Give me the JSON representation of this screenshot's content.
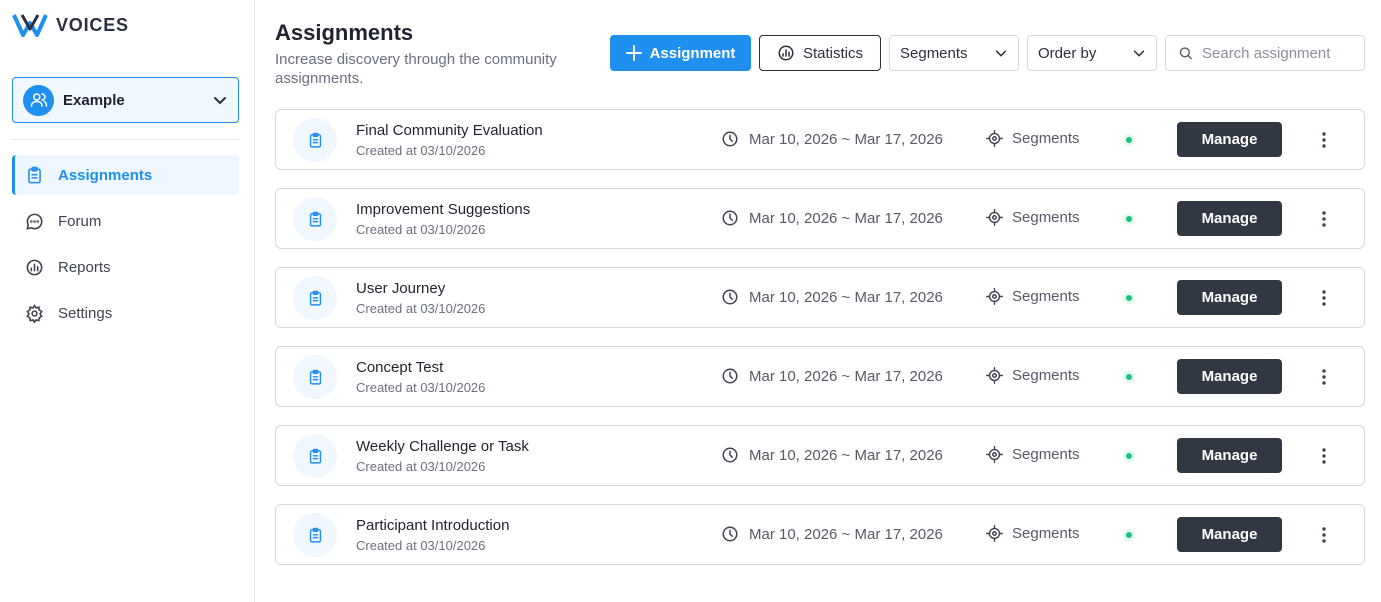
{
  "app": {
    "name": "VOICES"
  },
  "workspace": {
    "name": "Example"
  },
  "nav": [
    {
      "label": "Assignments",
      "icon": "clipboard-icon",
      "active": true
    },
    {
      "label": "Forum",
      "icon": "chat-icon",
      "active": false
    },
    {
      "label": "Reports",
      "icon": "chart-icon",
      "active": false
    },
    {
      "label": "Settings",
      "icon": "gear-icon",
      "active": false
    }
  ],
  "header": {
    "title": "Assignments",
    "subtitle": "Increase discovery through the community assignments."
  },
  "toolbar": {
    "add_label": "Assignment",
    "statistics_label": "Statistics",
    "segments_label": "Segments",
    "order_label": "Order by",
    "search_placeholder": "Search assignment"
  },
  "assignments": [
    {
      "title": "Final Community Evaluation",
      "created": "Created at 03/10/2026",
      "dates": "Mar 10, 2026 ~ Mar 17, 2026",
      "segments": "Segments",
      "manage": "Manage"
    },
    {
      "title": "Improvement Suggestions",
      "created": "Created at 03/10/2026",
      "dates": "Mar 10, 2026 ~ Mar 17, 2026",
      "segments": "Segments",
      "manage": "Manage"
    },
    {
      "title": "User Journey",
      "created": "Created at 03/10/2026",
      "dates": "Mar 10, 2026 ~ Mar 17, 2026",
      "segments": "Segments",
      "manage": "Manage"
    },
    {
      "title": "Concept Test",
      "created": "Created at 03/10/2026",
      "dates": "Mar 10, 2026 ~ Mar 17, 2026",
      "segments": "Segments",
      "manage": "Manage"
    },
    {
      "title": "Weekly Challenge or Task",
      "created": "Created at 03/10/2026",
      "dates": "Mar 10, 2026 ~ Mar 17, 2026",
      "segments": "Segments",
      "manage": "Manage"
    },
    {
      "title": "Participant Introduction",
      "created": "Created at 03/10/2026",
      "dates": "Mar 10, 2026 ~ Mar 17, 2026",
      "segments": "Segments",
      "manage": "Manage"
    }
  ],
  "colors": {
    "accent": "#1f8ff0",
    "dark": "#323744",
    "status_active": "#19c37d"
  }
}
